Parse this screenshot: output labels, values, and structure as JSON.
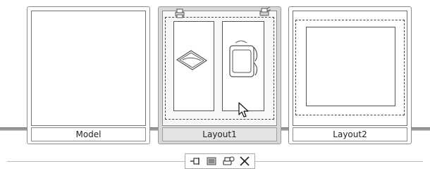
{
  "layout_tabs": [
    {
      "label": "Model",
      "selected": false
    },
    {
      "label": "Layout1",
      "selected": true
    },
    {
      "label": "Layout2",
      "selected": false
    }
  ],
  "toolbar": {
    "buttons": [
      {
        "icon": "pin-icon"
      },
      {
        "icon": "new-layout-icon"
      },
      {
        "icon": "publish-icon"
      },
      {
        "icon": "close-icon"
      }
    ]
  },
  "colors": {
    "selected_background": "#d8d8d8",
    "baseline": "#9a9a9a"
  }
}
